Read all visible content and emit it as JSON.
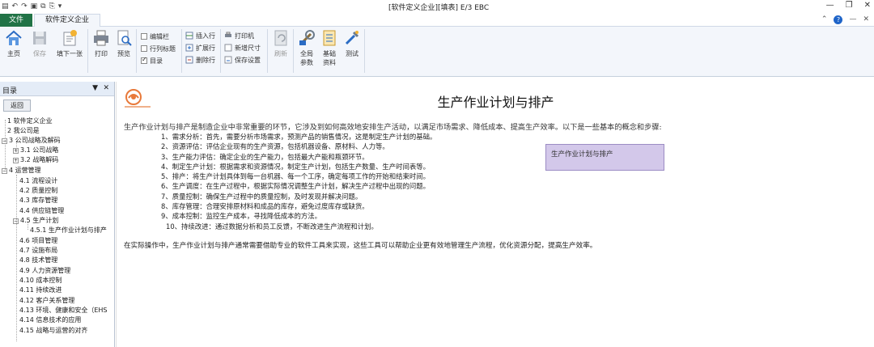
{
  "window": {
    "title": "[软件定义企业][填表]   E/3 EBC"
  },
  "tabs": {
    "file": "文件",
    "active": "软件定义企业"
  },
  "ribbon": {
    "home": "主页",
    "save": "保存",
    "fill_next": "填下一张",
    "print": "打印",
    "preview": "预览",
    "edit_bar": "编辑栏",
    "row_col_title": "行列标题",
    "toc": "目录",
    "insert_row": "插入行",
    "expand_row": "扩展行",
    "delete_row": "删除行",
    "printer": "打印机",
    "new_size": "新增尺寸",
    "save_settings": "保存设置",
    "refresh": "刷新",
    "global_params": [
      "全局",
      "参数"
    ],
    "base_data": [
      "基础",
      "资料"
    ],
    "test": "测试",
    "checkboxes": {
      "edit_bar": false,
      "row_col_title": false,
      "toc": true
    }
  },
  "nav": {
    "header": "目录",
    "back": "返回",
    "items": [
      "1  软件定义企业",
      "2  我公司是",
      "3  公司战略及解码",
      "3.1  公司战略",
      "3.2  战略解码",
      "4  运营管理",
      "4.1  流程设计",
      "4.2  质量控制",
      "4.3  库存管理",
      "4.4  供应链管理",
      "4.5  生产计划",
      "4.5.1  生产作业计划与排产",
      "4.6  项目管理",
      "4.7  设施布局",
      "4.8  技术管理",
      "4.9  人力资源管理",
      "4.10  成本控制",
      "4.11  持续改进",
      "4.12  客户关系管理",
      "4.13  环境、健康和安全（EHS",
      "4.14  信息技术的应用",
      "4.15  战略与运营的对齐"
    ]
  },
  "doc": {
    "title": "生产作业计划与排产",
    "intro": "生产作业计划与排产是制造企业中非常重要的环节，它涉及到如何高效地安排生产活动，以满足市场需求、降低成本、提高生产效率。以下是一些基本的概念和步骤:",
    "items": [
      "1、需求分析：首先，需要分析市场需求，预测产品的销售情况，这是制定生产计划的基础。",
      "2、资源评估：评估企业现有的生产资源，包括机器设备、原材料、人力等。",
      "3、生产能力评估：确定企业的生产能力，包括最大产能和瓶颈环节。",
      "4、制定生产计划：根据需求和资源情况，制定生产计划，包括生产数量、生产时间表等。",
      "5、排产：将生产计划具体到每一台机器、每一个工序，确定每项工作的开始和结束时间。",
      "6、生产调度：在生产过程中，根据实际情况调整生产计划，解决生产过程中出现的问题。",
      "7、质量控制：确保生产过程中的质量控制，及时发现并解决问题。",
      "8、库存管理：合理安排原材料和成品的库存，避免过度库存或缺货。",
      "9、成本控制：监控生产成本，寻找降低成本的方法。",
      "10、持续改进：通过数据分析和员工反馈，不断改进生产流程和计划。"
    ],
    "outro": "在实际操作中，生产作业计划与排产通常需要借助专业的软件工具来实现，这些工具可以帮助企业更有效地管理生产流程，优化资源分配，提高生产效率。",
    "callout": "生产作业计划与排产"
  }
}
